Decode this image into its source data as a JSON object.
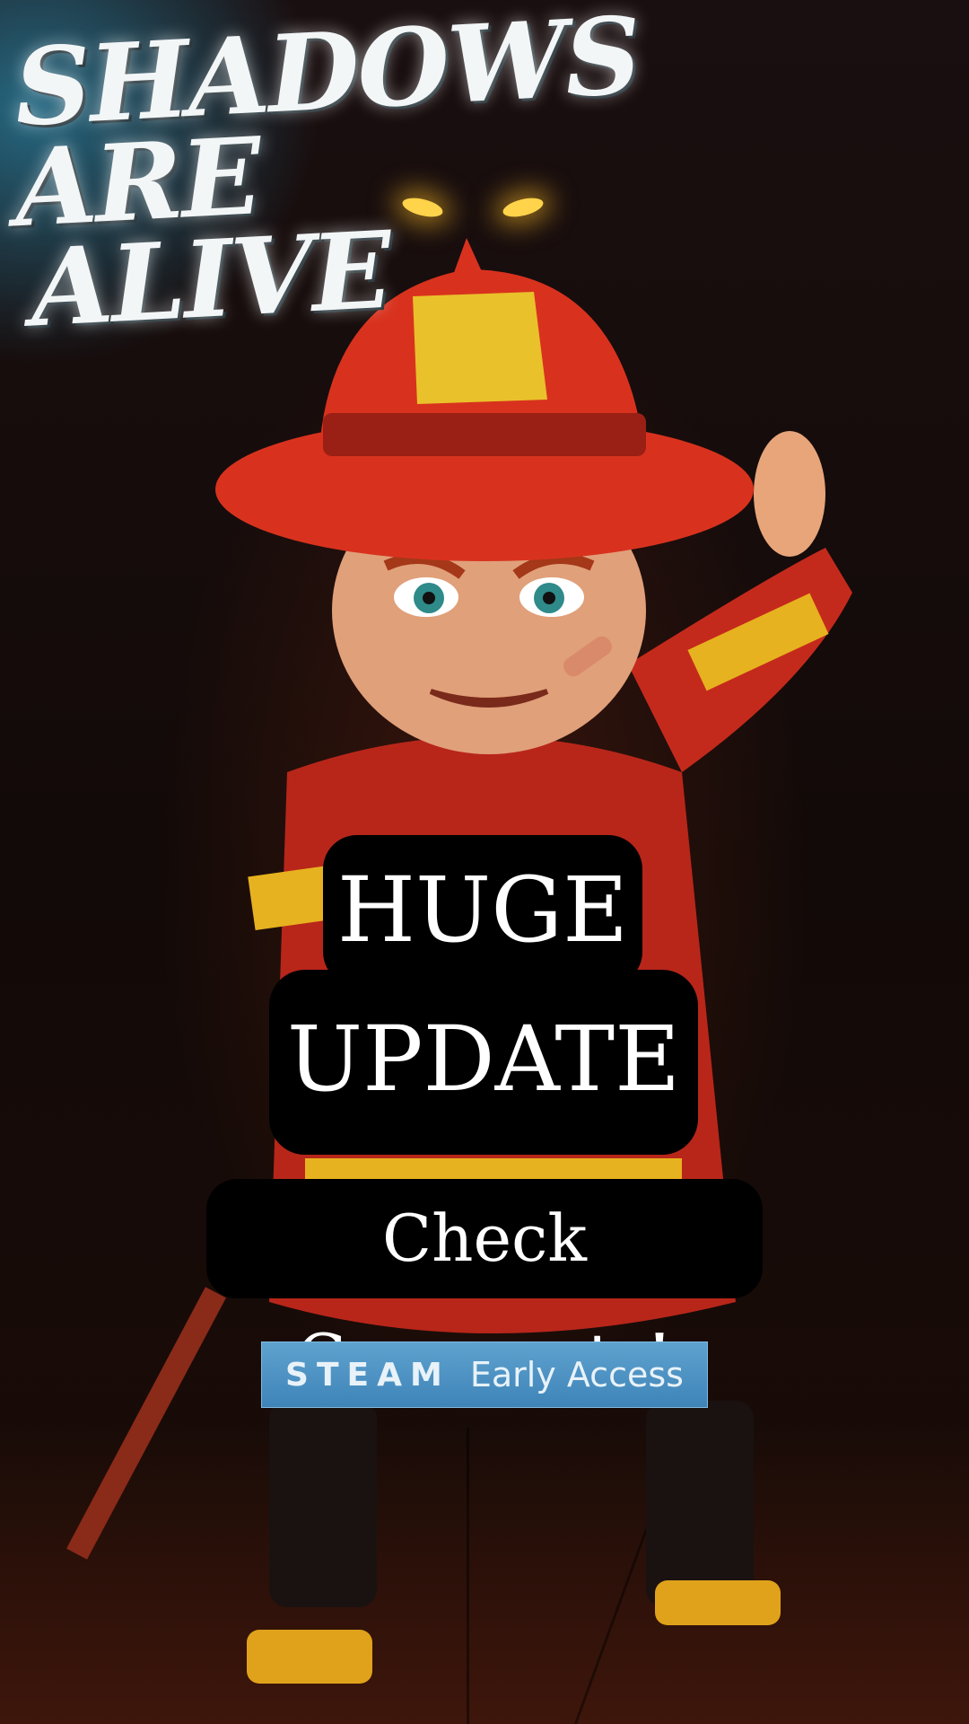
{
  "game_logo": {
    "line1": "SHADOWS",
    "line2": "ARE",
    "line3": "ALIVE"
  },
  "headline": {
    "line1": "HUGE",
    "line2": "UPDATE"
  },
  "cta": "Check Comments!",
  "steam_badge": {
    "brand": "STEAM",
    "label": "Early Access"
  },
  "colors": {
    "eyes": "#ffd34a",
    "badge": "#4a8fc2",
    "pill": "#000000",
    "helmet": "#d8321e"
  }
}
